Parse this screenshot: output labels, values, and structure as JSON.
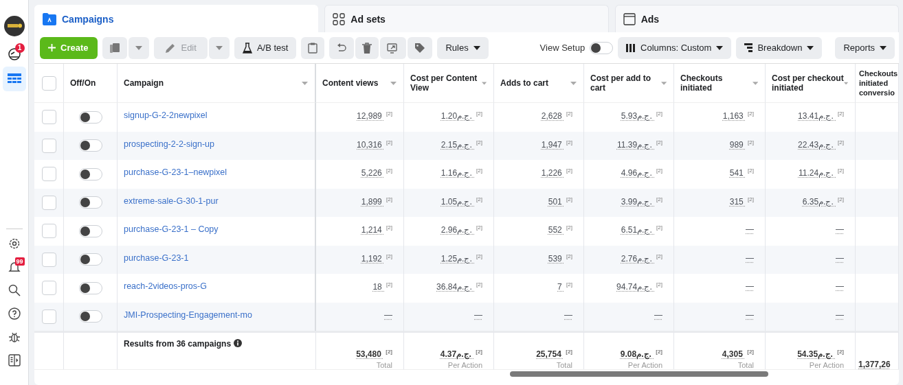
{
  "sidebar": {
    "items": [
      {
        "selected": false,
        "badge": "1"
      },
      {
        "selected": true
      },
      {
        "selected": false
      },
      {
        "selected": false,
        "badge": "99"
      },
      {
        "selected": false
      },
      {
        "selected": false
      },
      {
        "selected": false
      },
      {
        "selected": false
      }
    ]
  },
  "tabs": [
    {
      "label": "Campaigns",
      "selected": true
    },
    {
      "label": "Ad sets",
      "selected": false
    },
    {
      "label": "Ads",
      "selected": false
    }
  ],
  "toolbar": {
    "create": "Create",
    "edit": {
      "label": "Edit",
      "disabled": true
    },
    "ab_test": "A/B test",
    "rules": "Rules",
    "view_setup": {
      "label": "View Setup",
      "on": false
    },
    "columns": "Columns: Custom",
    "breakdown": "Breakdown",
    "reports": "Reports"
  },
  "table": {
    "all_checked": false,
    "columns": [
      "Off/On",
      "Campaign",
      "Content views",
      "Cost per Content View",
      "Adds to cart",
      "Cost per add to cart",
      "Checkouts initiated",
      "Cost per checkout initiated",
      "Checkouts initiated conversio"
    ],
    "rows": [
      {
        "checked": false,
        "on": false,
        "name": "signup-G-2-2newpixel",
        "values": [
          "12,989 $^{[2]}$",
          "1.20ج.م. $^{[2]}$",
          "2,628 $^{[2]}$",
          "5.93ج.م. $^{[2]}$",
          "1,163 $^{[2]}$",
          "13.41ج.م. $^{[2]}$"
        ]
      },
      {
        "checked": false,
        "on": false,
        "name": "prospecting-2-2-sign-up",
        "values": [
          "10,316 $^{[2]}$",
          "2.15ج.م. $^{[2]}$",
          "1,947 $^{[2]}$",
          "11.39ج.م. $^{[2]}$",
          "989 $^{[2]}$",
          "22.43ج.م. $^{[2]}$"
        ]
      },
      {
        "checked": false,
        "on": false,
        "name": "purchase-G-23-1–newpixel",
        "values": [
          "5,226 $^{[2]}$",
          "1.16ج.م. $^{[2]}$",
          "1,226 $^{[2]}$",
          "4.96ج.م. $^{[2]}$",
          "541 $^{[2]}$",
          "11.24ج.م. $^{[2]}$"
        ]
      },
      {
        "checked": false,
        "on": false,
        "name": "extreme-sale-G-30-1-pur",
        "values": [
          "1,899 $^{[2]}$",
          "1.05ج.م. $^{[2]}$",
          "501 $^{[2]}$",
          "3.99ج.م. $^{[2]}$",
          "315 $^{[2]}$",
          "6.35ج.م. $^{[2]}$"
        ]
      },
      {
        "checked": false,
        "on": false,
        "name": "purchase-G-23-1 – Copy",
        "values": [
          "1,214 $^{[2]}$",
          "2.96ج.م. $^{[2]}$",
          "552 $^{[2]}$",
          "6.51ج.م. $^{[2]}$",
          "—",
          "—"
        ]
      },
      {
        "checked": false,
        "on": false,
        "name": "purchase-G-23-1",
        "values": [
          "1,192 $^{[2]}$",
          "1.25ج.م. $^{[2]}$",
          "539 $^{[2]}$",
          "2.76ج.م. $^{[2]}$",
          "—",
          "—"
        ]
      },
      {
        "checked": false,
        "on": false,
        "name": "reach-2videos-pros-G",
        "values": [
          "18 $^{[2]}$",
          "36.84ج.م. $^{[2]}$",
          "7 $^{[2]}$",
          "94.74ج.م. $^{[2]}$",
          "—",
          "—"
        ]
      },
      {
        "checked": false,
        "on": false,
        "name": "JMI-Prospecting-Engagement-mo",
        "values": [
          "—",
          "—",
          "—",
          "—",
          "—",
          "—"
        ]
      }
    ],
    "footer": {
      "label": "Results from 36 campaigns",
      "values": [
        {
          "value": "53,480 $^{[2]}$",
          "sub": "Total"
        },
        {
          "value": "4.37ج.م. $^{[2]}$",
          "sub": "Per Action"
        },
        {
          "value": "25,754 $^{[2]}$",
          "sub": "Total"
        },
        {
          "value": "9.08ج.م. $^{[2]}$",
          "sub": "Per Action"
        },
        {
          "value": "4,305 $^{[2]}$",
          "sub": "Total"
        },
        {
          "value": "54.35ج.م. $^{[2]}$",
          "sub": "Per Action"
        },
        {
          "value": "1,377,26"
        }
      ]
    }
  }
}
